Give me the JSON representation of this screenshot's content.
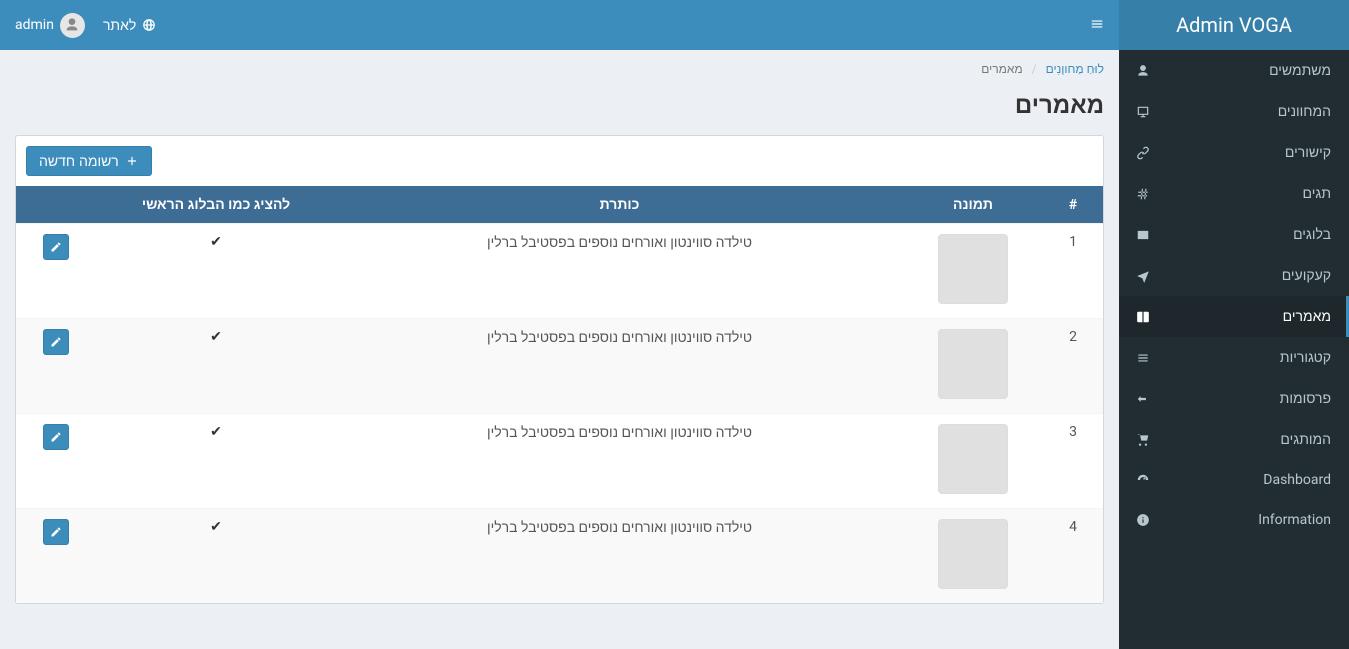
{
  "brand": "Admin VOGA",
  "topnav": {
    "site_link": "לאתר",
    "user_name": "admin"
  },
  "sidebar": {
    "items": [
      {
        "label": "משתמשים",
        "icon": "user-icon"
      },
      {
        "label": "המחוונים",
        "icon": "gauge-icon"
      },
      {
        "label": "קישורים",
        "icon": "link-icon"
      },
      {
        "label": "תגים",
        "icon": "hash-icon"
      },
      {
        "label": "בלוגים",
        "icon": "card-icon"
      },
      {
        "label": "קעקועים",
        "icon": "plane-icon"
      },
      {
        "label": "מאמרים",
        "icon": "book-icon"
      },
      {
        "label": "קטגוריות",
        "icon": "list-icon"
      },
      {
        "label": "פרסומות",
        "icon": "arrow-icon"
      },
      {
        "label": "המותגים",
        "icon": "cart-icon"
      },
      {
        "label": "Dashboard",
        "icon": "dashboard-icon"
      },
      {
        "label": "Information",
        "icon": "info-icon"
      }
    ],
    "active_index": 6
  },
  "breadcrumb": {
    "home": "לוּחַ מַחווָנִים",
    "current": "מאמרים"
  },
  "page_title": "מאמרים",
  "new_button": "רשומה חדשה",
  "table": {
    "headers": {
      "index": "#",
      "image": "תמונה",
      "title": "כותרת",
      "main_blog": "להציג כמו הבלוג הראשי",
      "actions": ""
    },
    "rows": [
      {
        "n": 1,
        "thumb": "thumb1",
        "title": "טילדה סווינטון ואורחים נוספים בפסטיבל ברלין",
        "is_main": true
      },
      {
        "n": 2,
        "thumb": "thumb2",
        "title": "טילדה סווינטון ואורחים נוספים בפסטיבל ברלין",
        "is_main": true
      },
      {
        "n": 3,
        "thumb": "thumb3",
        "title": "טילדה סווינטון ואורחים נוספים בפסטיבל ברלין",
        "is_main": true
      },
      {
        "n": 4,
        "thumb": "thumb4",
        "title": "טילדה סווינטון ואורחים נוספים בפסטיבל ברלין",
        "is_main": true
      }
    ]
  }
}
